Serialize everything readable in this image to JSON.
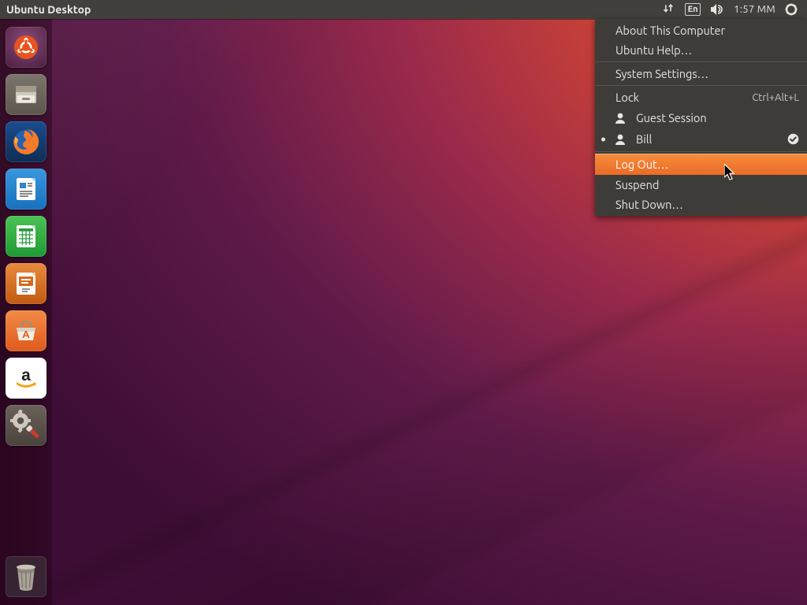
{
  "panel": {
    "title": "Ubuntu Desktop",
    "language_indicator": "En",
    "clock": "1:57 ΜΜ"
  },
  "launcher": {
    "items": [
      {
        "name": "dash-icon",
        "label": "Dash",
        "bg": "#5e2750"
      },
      {
        "name": "files-icon",
        "label": "Files",
        "bg": "#6a635a"
      },
      {
        "name": "firefox-icon",
        "label": "Firefox",
        "bg": "#173a66"
      },
      {
        "name": "writer-icon",
        "label": "LibreOffice Writer",
        "bg": "#1576c4"
      },
      {
        "name": "calc-icon",
        "label": "LibreOffice Calc",
        "bg": "#1c9a3a"
      },
      {
        "name": "impress-icon",
        "label": "LibreOffice Impress",
        "bg": "#c25a12"
      },
      {
        "name": "software-icon",
        "label": "Ubuntu Software",
        "bg": "#e46b2b"
      },
      {
        "name": "amazon-icon",
        "label": "Amazon",
        "bg": "#ffffff"
      },
      {
        "name": "settings-icon",
        "label": "System Settings",
        "bg": "#574f49"
      }
    ],
    "trash_label": "Trash"
  },
  "menu": {
    "about": "About This Computer",
    "help": "Ubuntu Help…",
    "system_settings": "System Settings…",
    "lock": "Lock",
    "lock_shortcut": "Ctrl+Alt+L",
    "guest": "Guest Session",
    "current_user": "Bill",
    "logout": "Log Out…",
    "suspend": "Suspend",
    "shutdown": "Shut Down…"
  }
}
